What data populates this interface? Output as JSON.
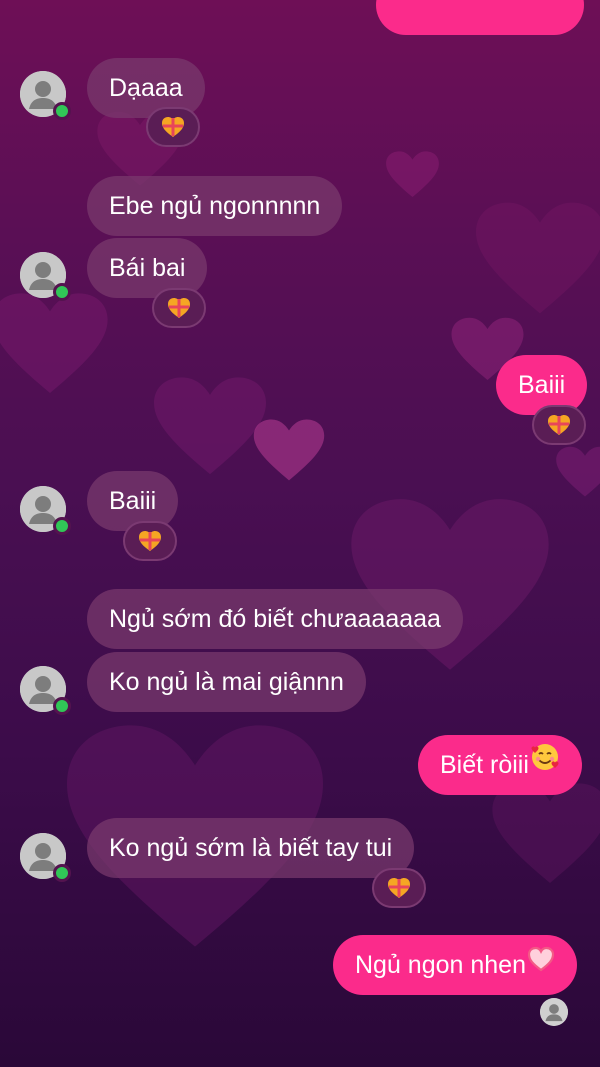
{
  "background": {
    "top_color": "#6e0f56",
    "bottom_color": "#2a0838"
  },
  "colors": {
    "incoming_bubble": "#7a3a6e",
    "outgoing_bubble": "#fb2b8b",
    "online_indicator": "#31c657"
  },
  "messages": [
    {
      "id": "m0",
      "side": "outgoing",
      "text": ""
    },
    {
      "id": "m1",
      "side": "incoming",
      "text": "Dạaaa",
      "reaction": "gift-heart-icon"
    },
    {
      "id": "m2",
      "side": "incoming",
      "text": "Ebe ngủ ngonnnnn"
    },
    {
      "id": "m3",
      "side": "incoming",
      "text": "Bái bai",
      "reaction": "gift-heart-icon"
    },
    {
      "id": "m4",
      "side": "outgoing",
      "text": "Baiii",
      "reaction": "gift-heart-icon"
    },
    {
      "id": "m5",
      "side": "incoming",
      "text": "Baiii",
      "reaction": "gift-heart-icon"
    },
    {
      "id": "m6",
      "side": "incoming",
      "text": "Ngủ sớm đó biết chưaaaaaaa"
    },
    {
      "id": "m7",
      "side": "incoming",
      "text": "Ko ngủ là mai giậnnn"
    },
    {
      "id": "m8",
      "side": "outgoing",
      "text": "Biết ròiii",
      "emoji": "smiling-face-with-hearts-icon"
    },
    {
      "id": "m9",
      "side": "incoming",
      "text": "Ko ngủ sớm là biết tay tui",
      "reaction": "gift-heart-icon"
    },
    {
      "id": "m10",
      "side": "outgoing",
      "text": "Ngủ ngon nhen",
      "emoji": "pink-heart-icon",
      "seen": true
    }
  ]
}
